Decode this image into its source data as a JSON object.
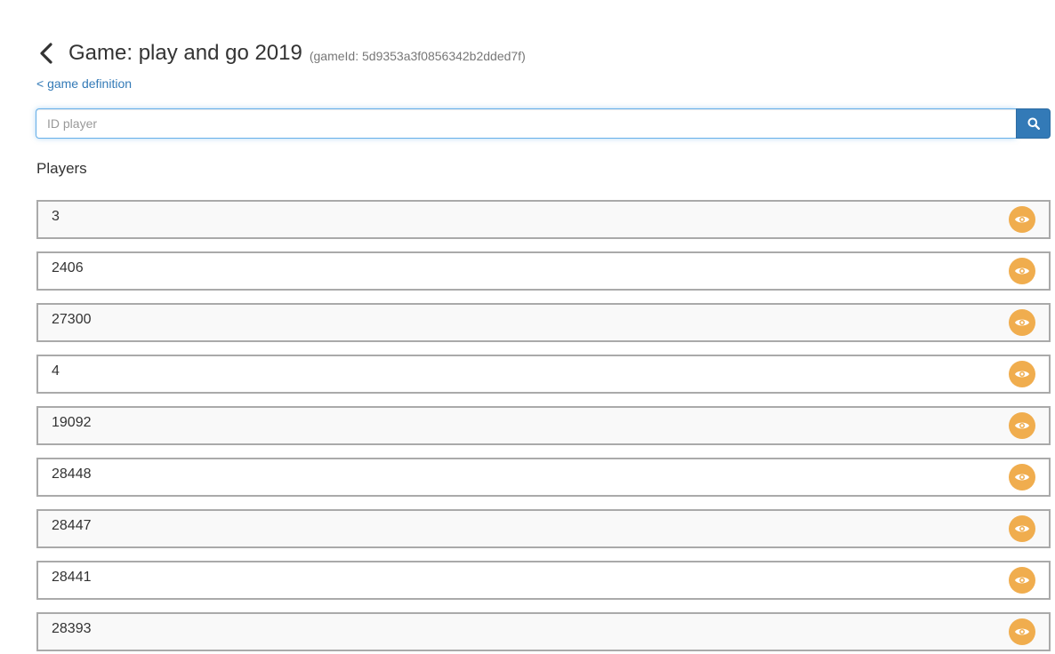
{
  "header": {
    "title": "Game: play and go 2019",
    "game_id": "(gameId: 5d9353a3f0856342b2dded7f)",
    "back_icon": "chevron-left-icon"
  },
  "links": {
    "game_definition": "< game definition"
  },
  "search": {
    "placeholder": "ID player",
    "value": "",
    "button_icon": "search-icon"
  },
  "players": {
    "title": "Players",
    "view_icon": "eye-icon",
    "items": [
      {
        "id": "3"
      },
      {
        "id": "2406"
      },
      {
        "id": "27300"
      },
      {
        "id": "4"
      },
      {
        "id": "19092"
      },
      {
        "id": "28448"
      },
      {
        "id": "28447"
      },
      {
        "id": "28441"
      },
      {
        "id": "28393"
      }
    ]
  },
  "colors": {
    "primary": "#337ab7",
    "warning": "#f0ad4e",
    "row_border": "#aaaaaa",
    "row_stripe": "#f9f9f9"
  }
}
